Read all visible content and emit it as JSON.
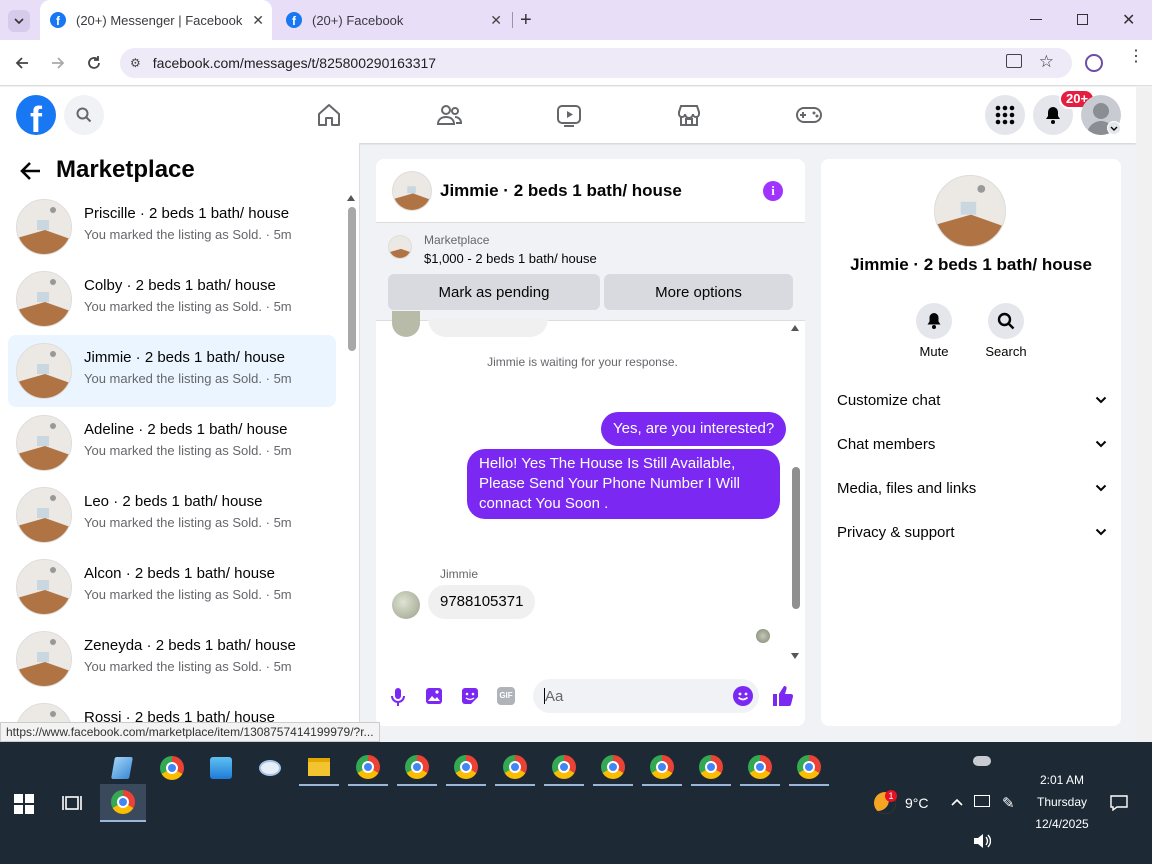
{
  "browser": {
    "tabs": [
      {
        "title": "(20+) Messenger | Facebook",
        "active": true
      },
      {
        "title": "(20+) Facebook",
        "active": false
      }
    ],
    "url": "facebook.com/messages/t/825800290163317",
    "status_url": "https://www.facebook.com/marketplace/item/1308757414199979/?r..."
  },
  "header": {
    "notification_badge": "20+",
    "brand_color": "#1877f2"
  },
  "sidebar": {
    "title": "Marketplace",
    "conversations": [
      {
        "name": "Priscille · 2 beds 1 bath/ house",
        "snippet": "You marked the listing as Sold. · 5m"
      },
      {
        "name": "Colby · 2 beds 1 bath/ house",
        "snippet": "You marked the listing as Sold. · 5m"
      },
      {
        "name": "Jimmie · 2 beds 1 bath/ house",
        "snippet": "You marked the listing as Sold. · 5m",
        "active": true
      },
      {
        "name": "Adeline · 2 beds 1 bath/ house",
        "snippet": "You marked the listing as Sold. · 5m"
      },
      {
        "name": "Leo · 2 beds 1 bath/ house",
        "snippet": "You marked the listing as Sold. · 5m"
      },
      {
        "name": "Alcon · 2 beds 1 bath/ house",
        "snippet": "You marked the listing as Sold. · 5m"
      },
      {
        "name": "Zeneyda · 2 beds 1 bath/ house",
        "snippet": "You marked the listing as Sold. · 5m"
      },
      {
        "name": "Rossi · 2 beds 1 bath/ house",
        "snippet": ""
      }
    ]
  },
  "chat": {
    "title": "Jimmie · 2 beds 1 bath/ house",
    "listing_source": "Marketplace",
    "listing_price": "$1,000 - 2 beds 1 bath/ house",
    "mark_pending_label": "Mark as pending",
    "more_options_label": "More options",
    "waiting_notice": "Jimmie is waiting for your response.",
    "messages": [
      {
        "from": "me",
        "text": "Yes, are you interested?"
      },
      {
        "from": "me",
        "text": "Hello! Yes The House  Is Still Available, Please Send Your Phone Number I Will connact You Soon ."
      },
      {
        "from": "Jimmie",
        "sender_label": "Jimmie",
        "text": "9788105371"
      }
    ],
    "composer_placeholder": "Aa",
    "accent_color": "#7a28f2"
  },
  "details": {
    "name": "Jimmie · 2 beds 1 bath/ house",
    "mute_label": "Mute",
    "search_label": "Search",
    "sections": [
      "Customize chat",
      "Chat members",
      "Media, files and links",
      "Privacy & support"
    ]
  },
  "taskbar": {
    "temperature": "9°C",
    "weather_badge": "1",
    "time": "2:01 AM",
    "day": "Thursday",
    "date": "12/4/2025"
  }
}
